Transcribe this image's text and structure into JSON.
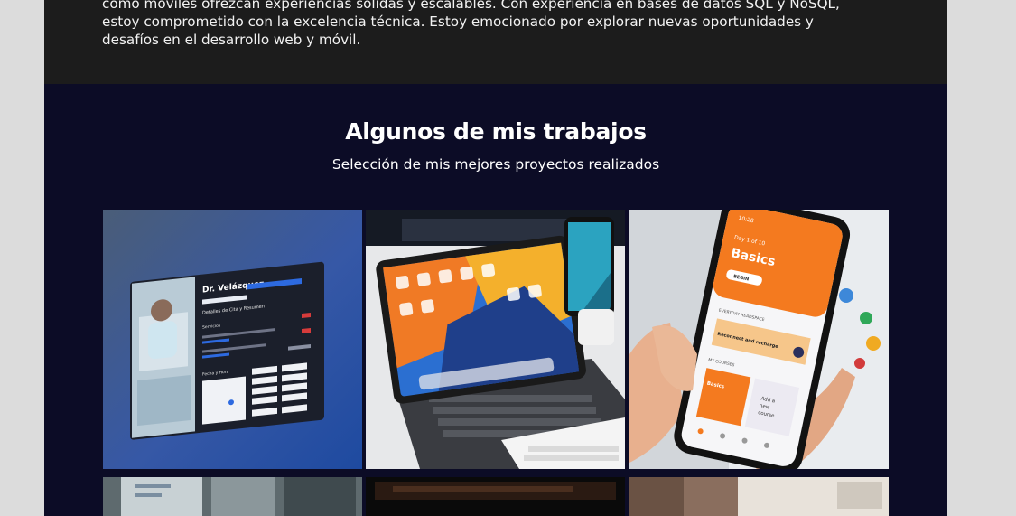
{
  "about": {
    "lines": [
      "como móviles ofrezcan experiencias sólidas y escalables. Con experiencia en bases de datos SQL y NoSQL,",
      "estoy comprometido con la excelencia técnica. Estoy emocionado por explorar nuevas oportunidades y",
      "desafíos en el desarrollo web y móvil."
    ]
  },
  "projects": {
    "title": "Algunos de mis trabajos",
    "subtitle": "Selección de mis mejores proyectos realizados"
  },
  "card1": {
    "doctor": "Dr. Velázquez",
    "heading": "Detalles de Cita y Resumen",
    "section": "Servicios",
    "date_label": "Fecha y Hora"
  },
  "card3": {
    "status": "10:28",
    "day": "Day 1 of 10",
    "title": "Basics",
    "begin": "BEGIN",
    "section1": "EVERYDAY HEADSPACE",
    "item1": "Reconnect and recharge",
    "section2": "MY COURSES",
    "course1": "Basics",
    "course2a": "Add a",
    "course2b": "new",
    "course2c": "course"
  },
  "colors": {
    "about_bg": "#1c1c1c",
    "projects_bg": "#0c0c26",
    "accent_orange": "#f47a1f",
    "accent_blue": "#2d6ae0"
  }
}
